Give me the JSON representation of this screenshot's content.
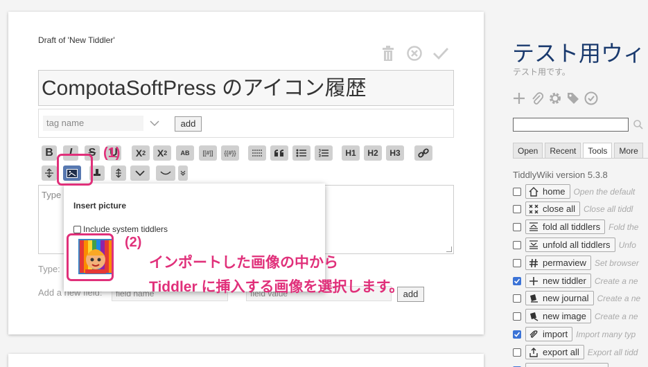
{
  "editor": {
    "draft_label": "Draft of 'New Tiddler'",
    "title_value": "CompotaSoftPress のアイコン履歴",
    "tag_placeholder": "tag name",
    "tag_add_label": "add",
    "body_placeholder": "Type",
    "type_label": "Type:",
    "add_field_label": "Add a new field:",
    "field_name_placeholder": "field name",
    "field_value_placeholder": "field value",
    "field_add_label": "add",
    "toolbar": {
      "bold": "B",
      "italic": "I",
      "strike": "S",
      "underline": "U",
      "superscript": "X",
      "sup_mark": "2",
      "subscript": "X",
      "sub_mark": "2",
      "smallcaps": "AB",
      "wikilink": "[[#]]",
      "transclude": "{{#}}",
      "h1": "H1",
      "h2": "H2",
      "h3": "H3"
    }
  },
  "popup": {
    "title": "Insert picture",
    "include_system_label": "Include system tiddlers"
  },
  "annotations": {
    "step1": "(1)",
    "step2": "(2)",
    "line1": "インポートした画像の中から",
    "line2": "Tiddler に挿入する画像を選択します。"
  },
  "sidebar": {
    "title": "テスト用ウィ",
    "subtitle": "テスト用です。",
    "tabs": [
      {
        "label": "Open"
      },
      {
        "label": "Recent"
      },
      {
        "label": "Tools"
      },
      {
        "label": "More"
      }
    ],
    "version": "TiddlyWiki version 5.3.8",
    "tools": [
      {
        "label": "home",
        "desc": "Open the default",
        "icon": "home-icon",
        "checked": false
      },
      {
        "label": "close all",
        "desc": "Close all tiddl",
        "icon": "close-all-icon",
        "checked": false
      },
      {
        "label": "fold all tiddlers",
        "desc": "Fold the",
        "icon": "fold-all-icon",
        "checked": false
      },
      {
        "label": "unfold all tiddlers",
        "desc": "Unfo",
        "icon": "unfold-all-icon",
        "checked": false
      },
      {
        "label": "permaview",
        "desc": "Set browser",
        "icon": "permaview-icon",
        "checked": false
      },
      {
        "label": "new tiddler",
        "desc": "Create a ne",
        "icon": "plus-icon",
        "checked": true
      },
      {
        "label": "new journal",
        "desc": "Create a ne",
        "icon": "journal-icon",
        "checked": false
      },
      {
        "label": "new image",
        "desc": "Create a ne",
        "icon": "image-icon",
        "checked": false
      },
      {
        "label": "import",
        "desc": "Import many typ",
        "icon": "import-icon",
        "checked": true
      },
      {
        "label": "export all",
        "desc": "Export all tidd",
        "icon": "export-icon",
        "checked": false
      }
    ]
  },
  "colors": {
    "accent": "#e0307a",
    "selected_button": "#5778b0",
    "site_title": "#1a3a6e"
  }
}
